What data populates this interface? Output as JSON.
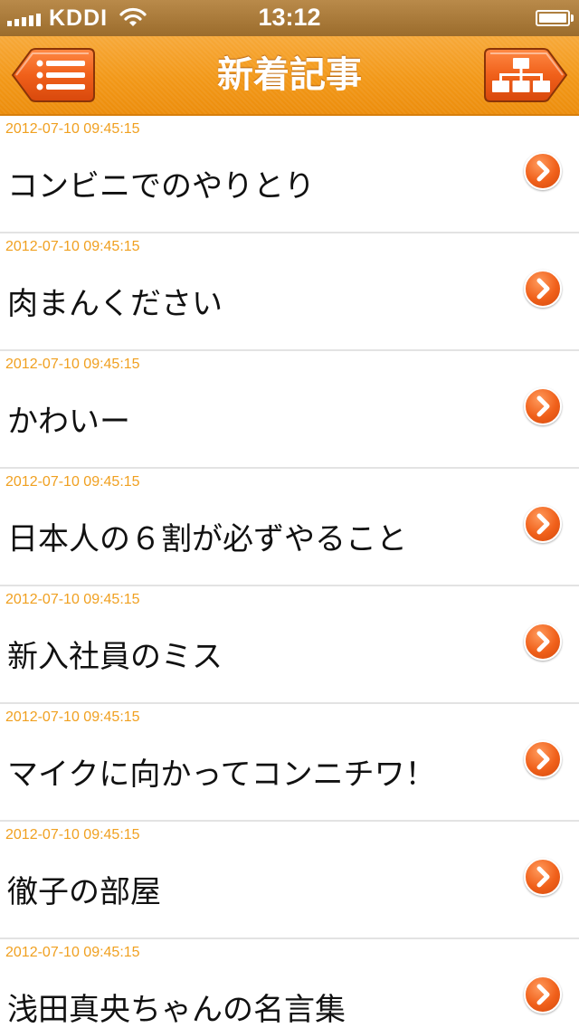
{
  "status_bar": {
    "carrier": "KDDI",
    "time": "13:12",
    "icons": [
      "signal-icon",
      "wifi-icon",
      "battery-icon"
    ]
  },
  "nav_bar": {
    "title": "新着記事",
    "left_button_icon": "list-menu-icon",
    "right_button_icon": "sitemap-icon"
  },
  "colors": {
    "nav_orange": "#f29818",
    "date_text": "#f0a020",
    "arrow_orange": "#f0601a"
  },
  "articles": [
    {
      "date": "2012-07-10 09:45:15",
      "title": "コンビニでのやりとり"
    },
    {
      "date": "2012-07-10 09:45:15",
      "title": "肉まんください"
    },
    {
      "date": "2012-07-10 09:45:15",
      "title": "かわいー"
    },
    {
      "date": "2012-07-10 09:45:15",
      "title": "日本人の６割が必ずやること"
    },
    {
      "date": "2012-07-10 09:45:15",
      "title": "新入社員のミス"
    },
    {
      "date": "2012-07-10 09:45:15",
      "title": "マイクに向かってコンニチワ！"
    },
    {
      "date": "2012-07-10 09:45:15",
      "title": "徹子の部屋"
    },
    {
      "date": "2012-07-10 09:45:15",
      "title": "浅田真央ちゃんの名言集"
    }
  ]
}
